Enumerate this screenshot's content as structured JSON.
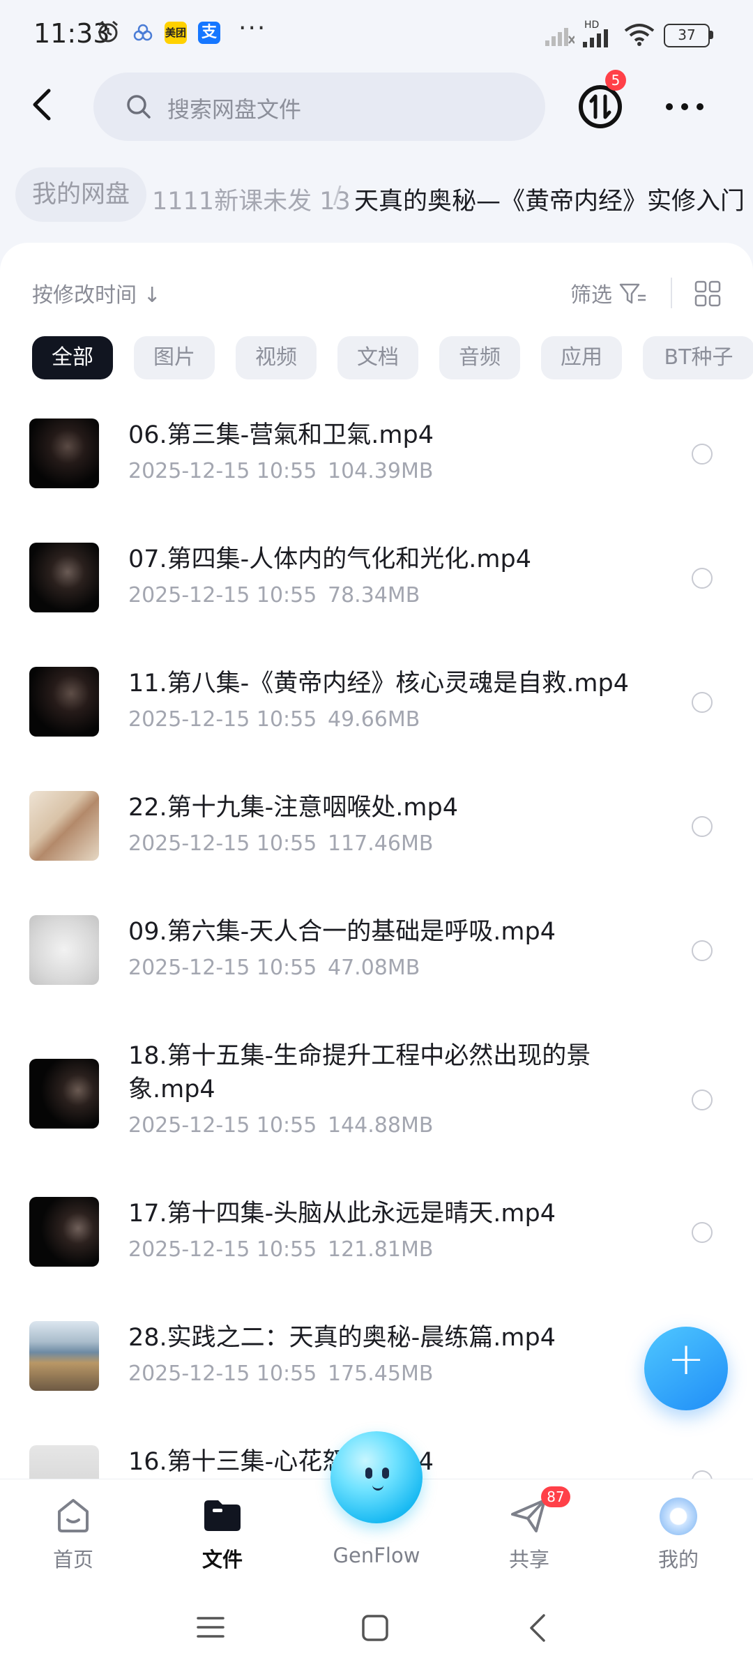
{
  "status_bar": {
    "time": "11:33",
    "app_icons": [
      "meituan",
      "alipay"
    ],
    "more": "···",
    "network": "HD",
    "battery": "37"
  },
  "header": {
    "search_placeholder": "搜索网盘文件",
    "transfer_badge": "5"
  },
  "breadcrumb": {
    "root": "我的网盘",
    "middle": "1111新课未发 13",
    "separator": "/",
    "current": "天真的奥秘—《黄帝内经》实修入门"
  },
  "toolbar": {
    "sort_label": "按修改时间 ↓",
    "filter_label": "筛选"
  },
  "tabs": [
    {
      "label": "全部",
      "active": true
    },
    {
      "label": "图片"
    },
    {
      "label": "视频"
    },
    {
      "label": "文档"
    },
    {
      "label": "音频"
    },
    {
      "label": "应用"
    },
    {
      "label": "BT种子"
    }
  ],
  "files": [
    {
      "name": "06.第三集-营氣和卫氣.mp4",
      "date": "2025-12-15  10:55",
      "size": "104.39MB",
      "thumb": "dark"
    },
    {
      "name": "07.第四集-人体内的气化和光化.mp4",
      "date": "2025-12-15  10:55",
      "size": "78.34MB",
      "thumb": "dark"
    },
    {
      "name": "11.第八集-《黄帝内经》核心灵魂是自救.mp4",
      "date": "2025-12-15  10:55",
      "size": "49.66MB",
      "thumb": "dark"
    },
    {
      "name": "22.第十九集-注意咽喉处.mp4",
      "date": "2025-12-15  10:55",
      "size": "117.46MB",
      "thumb": "art"
    },
    {
      "name": "09.第六集-天人合一的基础是呼吸.mp4",
      "date": "2025-12-15  10:55",
      "size": "47.08MB",
      "thumb": "grey"
    },
    {
      "name": "18.第十五集-生命提升工程中必然出现的景象.mp4",
      "date": "2025-12-15  10:55",
      "size": "144.88MB",
      "thumb": "dark"
    },
    {
      "name": "17.第十四集-头脑从此永远是晴天.mp4",
      "date": "2025-12-15  10:55",
      "size": "121.81MB",
      "thumb": "dark"
    },
    {
      "name": "28.实践之二：天真的奥秘-晨练篇.mp4",
      "date": "2025-12-15  10:55",
      "size": "175.45MB",
      "thumb": "outdoor"
    },
    {
      "name": "16.第十三集-心花怒放.mp4",
      "date": "",
      "size": "",
      "thumb": "grey"
    }
  ],
  "bottom_nav": [
    {
      "label": "首页",
      "icon": "home-icon"
    },
    {
      "label": "文件",
      "icon": "folder-icon",
      "active": true
    },
    {
      "label": "GenFlow",
      "icon": "genflow-orb"
    },
    {
      "label": "共享",
      "icon": "share-icon",
      "badge": "87"
    },
    {
      "label": "我的",
      "icon": "profile-icon"
    }
  ],
  "colors": {
    "accent": "#1f8df7",
    "active_tab": "#111520",
    "badge": "#ff4048"
  }
}
